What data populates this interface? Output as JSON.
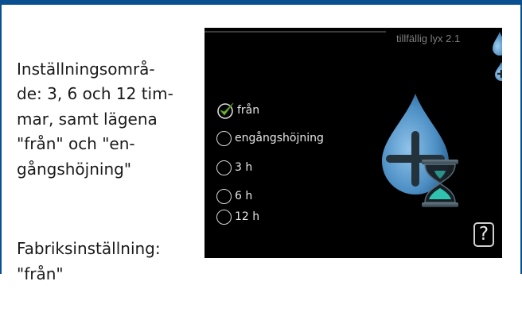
{
  "description": {
    "setting_range": "Inställningsområ-\nde: 3, 6 och 12 tim-\nmar, samt lägena\n\"från\" och \"en-\ngångshöjning\"",
    "factory_setting": "Fabriksinställning:\n\"från\""
  },
  "screen": {
    "title": "tillfällig lyx 2.1",
    "options": [
      {
        "label": "från",
        "selected": true
      },
      {
        "label": "engångshöjning",
        "selected": false
      },
      {
        "label": "3 h",
        "selected": false
      },
      {
        "label": "6 h",
        "selected": false
      },
      {
        "label": "12 h",
        "selected": false
      }
    ],
    "help_label": "?"
  },
  "colors": {
    "frame": "#0a4f8f",
    "screen_bg": "#000000",
    "drop_blue": "#4d8fc4",
    "check_green": "#7bbf3a"
  },
  "icons": {
    "selected": "checkmark-icon",
    "unselected": "radio-circle-icon",
    "help": "question-mark-icon",
    "comfort": "hot-water-drop-plus-hourglass-icon"
  }
}
